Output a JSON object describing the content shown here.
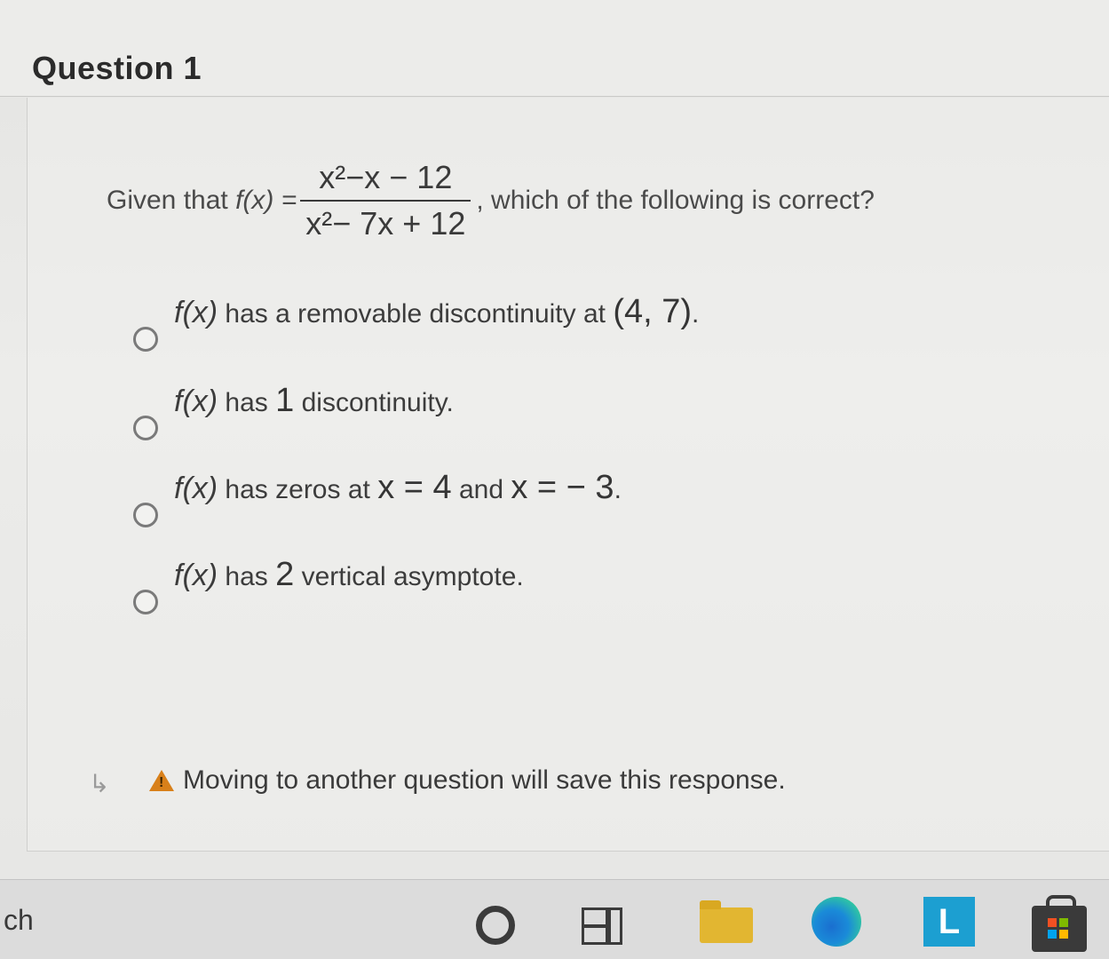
{
  "question": {
    "title": "Question 1",
    "stem": {
      "prefix": "Given that",
      "function": "f(x) =",
      "numerator": "x²−x − 12",
      "denominator": "x²− 7x + 12",
      "suffix": ", which of the following is correct?"
    },
    "options": [
      {
        "fx": "f(x)",
        "text": " has a removable discontinuity at ",
        "emph": "(4, 7)",
        "tail": "."
      },
      {
        "fx": "f(x)",
        "text": " has ",
        "emph": "1",
        "tail": " discontinuity."
      },
      {
        "fx": "f(x)",
        "text": " has zeros at ",
        "emph": "x = 4",
        "mid": " and ",
        "emph2": "x = − 3",
        "tail": "."
      },
      {
        "fx": "f(x)",
        "text": " has ",
        "emph": "2",
        "tail": " vertical asymptote."
      }
    ]
  },
  "notice": {
    "text": "Moving to another question will save this response.",
    "icon": "warning-icon",
    "icon_color": "#d8801a"
  },
  "taskbar": {
    "search_text": "ch",
    "icons": [
      "cortana-circle-icon",
      "task-view-icon",
      "file-explorer-icon",
      "edge-icon",
      "l-app-icon",
      "store-icon"
    ],
    "l_icon_label": "L"
  }
}
